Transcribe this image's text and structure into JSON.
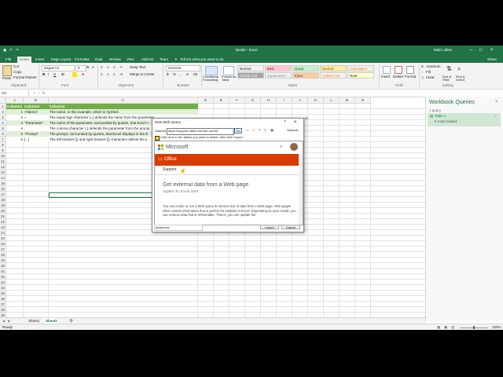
{
  "title": {
    "doc": "Book2 - Excel",
    "user": "Matt Lolline",
    "share": "Share"
  },
  "tabs": [
    "File",
    "Home",
    "Insert",
    "Page Layout",
    "Formulas",
    "Data",
    "Review",
    "View",
    "Add-ins",
    "Team"
  ],
  "tell_me": "Tell me what you want to do",
  "ribbon": {
    "paste": "Paste",
    "cut": "Cut",
    "copy": "Copy",
    "format_painter": "Format Painter",
    "clipboard": "Clipboard",
    "font_name": "Segoe UI",
    "font_size": "9",
    "font": "Font",
    "wrap": "Wrap Text",
    "merge": "Merge & Center",
    "alignment": "Alignment",
    "number_format": "General",
    "number": "Number",
    "cond_format": "Conditional Formatting",
    "format_table": "Format as Table",
    "styles_label": "Styles",
    "styles": [
      {
        "label": "Normal",
        "bg": "#ffffff",
        "fg": "#000000"
      },
      {
        "label": "Bad",
        "bg": "#ffc7ce",
        "fg": "#9c0006"
      },
      {
        "label": "Good",
        "bg": "#c6efce",
        "fg": "#006100"
      },
      {
        "label": "Neutral",
        "bg": "#ffeb9c",
        "fg": "#9c5700"
      },
      {
        "label": "Calculation",
        "bg": "#f2f2f2",
        "fg": "#fa7d00"
      },
      {
        "label": "Check Cell",
        "bg": "#a5a5a5",
        "fg": "#ffffff"
      },
      {
        "label": "Explanatory ...",
        "bg": "#ffffff",
        "fg": "#7f7f7f"
      },
      {
        "label": "Input",
        "bg": "#ffcc99",
        "fg": "#3f3f76"
      },
      {
        "label": "Linked Cell",
        "bg": "#ffffff",
        "fg": "#fa7d00"
      },
      {
        "label": "Note",
        "bg": "#ffffcc",
        "fg": "#000000"
      }
    ],
    "insert": "Insert",
    "delete": "Delete",
    "format": "Format",
    "cells": "Cells",
    "autosum": "AutoSum",
    "fill": "Fill",
    "clear": "Clear",
    "sort": "Sort & Filter",
    "find": "Find & Select",
    "editing": "Editing"
  },
  "formula_bar": {
    "name_box": "C9",
    "fx": "fx",
    "content": ""
  },
  "columns": [
    "A",
    "B",
    "C",
    "D",
    "E",
    "F",
    "G",
    "H",
    "I",
    "J",
    "K",
    "L",
    "M",
    "N"
  ],
  "table": {
    "headers": [
      "Column1",
      "Column2",
      "Column3"
    ],
    "rows": [
      [
        "1",
        "<Name>",
        "The name, in this example, which is Symbol."
      ],
      [
        "2",
        "=",
        "The equal sign character (=) defends the name from the parameter"
      ],
      [
        "3",
        "\"Parameter\"",
        "The name of the parameter, surrounded by quotes, that Excel c"
      ],
      [
        "4",
        ",",
        "The comma character (,) defends the parameter from the promp"
      ],
      [
        "5",
        "\"Prompt\"",
        "The prompt, surrounded by quotes, that Excel displays in the E"
      ],
      [
        "6",
        "[...]",
        "The left bracket ([) and right bracket (]) characters delimit the p"
      ]
    ],
    "overflow_tail": "el."
  },
  "row_numbers": [
    "1",
    "2",
    "3",
    "4",
    "5",
    "6",
    "7",
    "8",
    "9",
    "10",
    "11",
    "12",
    "13",
    "14",
    "15",
    "16",
    "17",
    "18",
    "19",
    "20",
    "21",
    "22",
    "23",
    "24",
    "25",
    "26",
    "27",
    "28",
    "29",
    "30",
    "31",
    "32",
    "33",
    "34",
    "35",
    "36",
    "37",
    "38",
    "39",
    "40",
    "41",
    "42"
  ],
  "sheets": [
    "Sheet1",
    "Sheet2"
  ],
  "active_sheet": "Sheet2",
  "status": {
    "left": "Ready",
    "zoom": "100%"
  },
  "queries_pane": {
    "title": "Workbook Queries",
    "count": "1 query",
    "query_name": "Table 1",
    "query_rows": "6 rows loaded."
  },
  "dialog": {
    "title": "New Web Query",
    "address_label": "Address:",
    "address": "https://support.office.com/en-us/Get",
    "go": "Go",
    "options": "Options...",
    "instruction": "Click  next to the tables you want to select, then click Import.",
    "ms_brand": "Microsoft",
    "office_label": "Office",
    "support": "Support",
    "heading": "Get external data from a Web page",
    "applies": "Applies To: Excel 2007",
    "body": "You can create or run a Web query to retrieve text or data from a Web page. Web pages often contain information that is perfect for analysis in Excel. Depending on your needs, you can retrieve data that is refreshable. That is, you can update the",
    "status": "javascript:",
    "import": "Import",
    "cancel": "Cancel",
    "accent": "#d83b01"
  }
}
